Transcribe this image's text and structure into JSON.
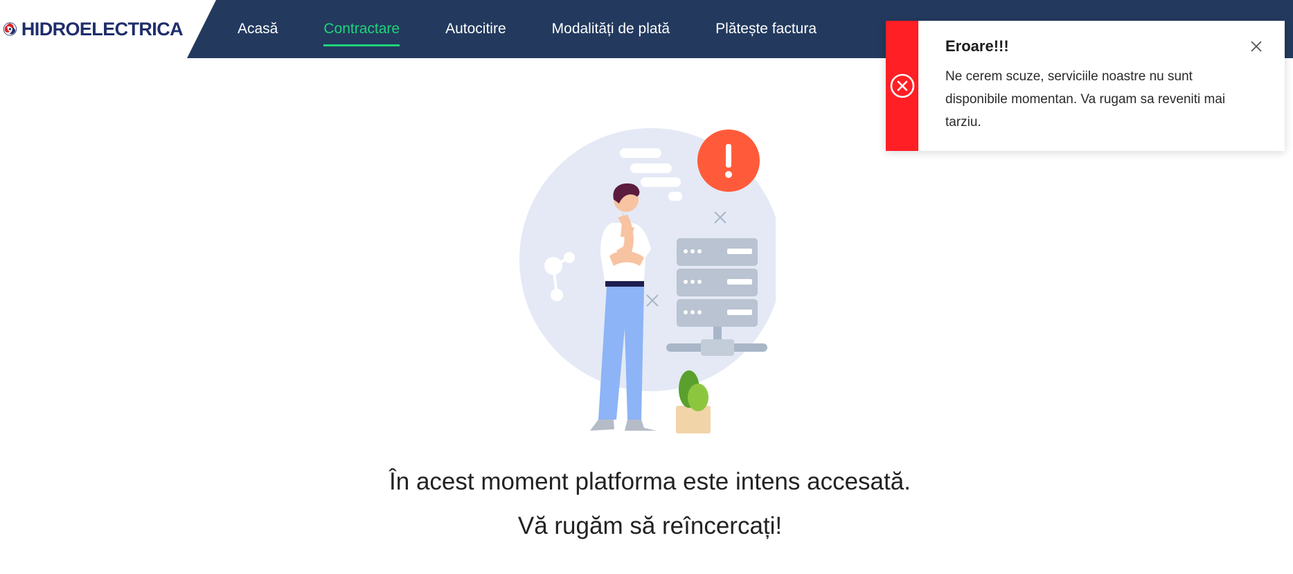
{
  "brand": {
    "name": "HIDROELECTRICA"
  },
  "nav": {
    "items": [
      {
        "label": "Acasă",
        "active": false
      },
      {
        "label": "Contractare",
        "active": true
      },
      {
        "label": "Autocitire",
        "active": false
      },
      {
        "label": "Modalități de plată",
        "active": false
      },
      {
        "label": "Plătește factura",
        "active": false
      }
    ]
  },
  "toast": {
    "title": "Eroare!!!",
    "message": "Ne cerem scuze, serviciile noastre nu sunt disponibile momentan. Va rugam sa reveniti mai tarziu.",
    "icon": "error-circle-x-icon",
    "accent": "#ff1f24"
  },
  "main": {
    "line1": "În acest moment platforma este intens accesată.",
    "line2": "Vă rugăm să reîncercați!"
  },
  "colors": {
    "navbar": "#233a5e",
    "nav_active": "#1fd37a"
  }
}
